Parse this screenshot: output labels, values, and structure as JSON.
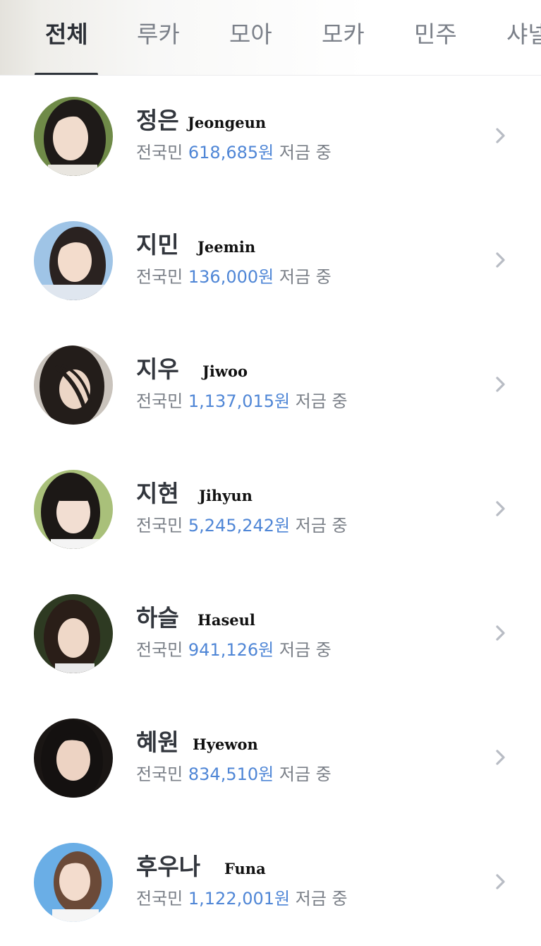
{
  "tabs": [
    {
      "label": "전체",
      "active": true
    },
    {
      "label": "루카",
      "active": false
    },
    {
      "label": "모아",
      "active": false
    },
    {
      "label": "모카",
      "active": false
    },
    {
      "label": "민주",
      "active": false
    },
    {
      "label": "샤넬",
      "active": false
    }
  ],
  "members": [
    {
      "name_ko": "정은",
      "name_en": "Jeongeun",
      "prefix": "전국민",
      "amount": "618,685원",
      "suffix": "저금 중"
    },
    {
      "name_ko": "지민",
      "name_en": "Jeemin",
      "prefix": "전국민",
      "amount": "136,000원",
      "suffix": "저금 중"
    },
    {
      "name_ko": "지우",
      "name_en": "Jiwoo",
      "prefix": "전국민",
      "amount": "1,137,015원",
      "suffix": "저금 중"
    },
    {
      "name_ko": "지현",
      "name_en": "Jihyun",
      "prefix": "전국민",
      "amount": "5,245,242원",
      "suffix": "저금 중"
    },
    {
      "name_ko": "하슬",
      "name_en": "Haseul",
      "prefix": "전국민",
      "amount": "941,126원",
      "suffix": "저금 중"
    },
    {
      "name_ko": "혜원",
      "name_en": "Hyewon",
      "prefix": "전국민",
      "amount": "834,510원",
      "suffix": "저금 중"
    },
    {
      "name_ko": "후우나",
      "name_en": "Funa",
      "prefix": "전국민",
      "amount": "1,122,001원",
      "suffix": "저금 중"
    }
  ],
  "icons": {
    "row_chevron": "chevron-right-icon"
  },
  "colors": {
    "amount": "#4f86d6",
    "active_tab": "#2b2f36",
    "inactive_tab": "#7b8089",
    "chevron": "#b8bcc4"
  }
}
